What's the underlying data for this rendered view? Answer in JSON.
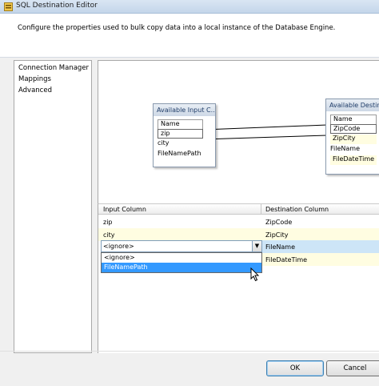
{
  "window": {
    "title": "SQL Destination Editor"
  },
  "header": {
    "description": "Configure the properties used to bulk copy data into a local instance of the Database Engine."
  },
  "nav": {
    "items": [
      {
        "label": "Connection Manager"
      },
      {
        "label": "Mappings"
      },
      {
        "label": "Advanced"
      }
    ]
  },
  "mapping": {
    "input_box": {
      "title": "Available Input C...",
      "header": "Name",
      "rows": [
        "zip",
        "city",
        "FileNamePath"
      ]
    },
    "dest_box": {
      "title": "Available Destin...",
      "header": "Name",
      "rows": [
        "ZipCode",
        "ZipCity",
        "FileName",
        "FileDateTime"
      ]
    }
  },
  "grid": {
    "columns": [
      "Input Column",
      "Destination Column"
    ],
    "rows": [
      {
        "input": "zip",
        "dest": "ZipCode"
      },
      {
        "input": "city",
        "dest": "ZipCity"
      },
      {
        "input": "<ignore>",
        "dest": "FileName"
      },
      {
        "input": "",
        "dest": "FileDateTime"
      }
    ],
    "dropdown": {
      "options": [
        "<ignore>",
        "FileNamePath"
      ],
      "highlighted": "FileNamePath"
    }
  },
  "buttons": {
    "ok": "OK",
    "cancel": "Cancel"
  },
  "colors": {
    "selection": "#3399ff",
    "row_highlight": "#fffde1",
    "selected_row": "#cde5f7"
  }
}
